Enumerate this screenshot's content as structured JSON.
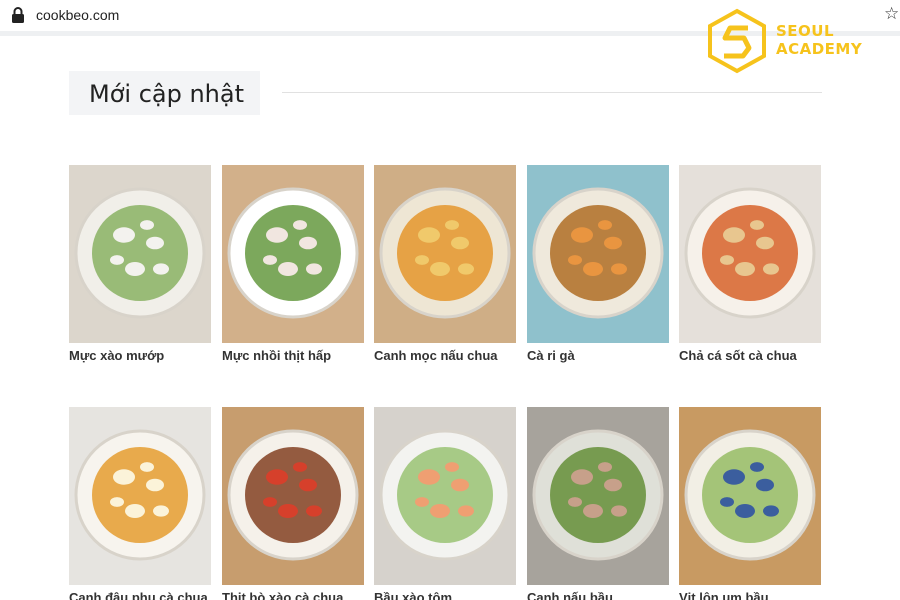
{
  "browser": {
    "url": "cookbeo.com",
    "lock_icon": "lock-icon",
    "bookmark_icon": "star-icon"
  },
  "watermark": {
    "line1": "SEOUL",
    "line2": "ACADEMY",
    "color": "#f6c31c"
  },
  "section": {
    "title": "Mới cập nhật"
  },
  "recipes": [
    {
      "title": "Mực xào mướp",
      "bg": "#dcd6cc",
      "plate": "#f1efe9",
      "food": "#8fb56a",
      "accent": "#f3f2ee"
    },
    {
      "title": "Mực nhồi thịt hấp",
      "bg": "#d2b08a",
      "plate": "#ffffff",
      "food": "#6e9f4a",
      "accent": "#f1e6e0"
    },
    {
      "title": "Canh mọc nấu chua",
      "bg": "#cfae86",
      "plate": "#eee6d4",
      "food": "#e49a35",
      "accent": "#f0c96b"
    },
    {
      "title": "Cà ri gà",
      "bg": "#8fc1cc",
      "plate": "#efe9dc",
      "food": "#b3742f",
      "accent": "#e99540"
    },
    {
      "title": "Chả cá sốt cà chua",
      "bg": "#e5e0da",
      "plate": "#f6f1ea",
      "food": "#d96a35",
      "accent": "#e8c68f"
    },
    {
      "title": "Canh đậu phụ cà chua",
      "bg": "#e6e4e0",
      "plate": "#f7f4ee",
      "food": "#e6a23a",
      "accent": "#fbf3d9"
    },
    {
      "title": "Thịt bò xào cà chua",
      "bg": "#c79d6e",
      "plate": "#f5f1ea",
      "food": "#8a4a2e",
      "accent": "#d6402b"
    },
    {
      "title": "Bầu xào tôm",
      "bg": "#d6d2cc",
      "plate": "#f3f3f0",
      "food": "#9fc57a",
      "accent": "#ef9f72"
    },
    {
      "title": "Canh nấu bầu",
      "bg": "#a7a39c",
      "plate": "#dfe0d8",
      "food": "#6c9441",
      "accent": "#c7a08a"
    },
    {
      "title": "Vịt lộn um bầu",
      "bg": "#c89a62",
      "plate": "#f2efe5",
      "food": "#9bbf6b",
      "accent": "#3b5e9e"
    }
  ]
}
